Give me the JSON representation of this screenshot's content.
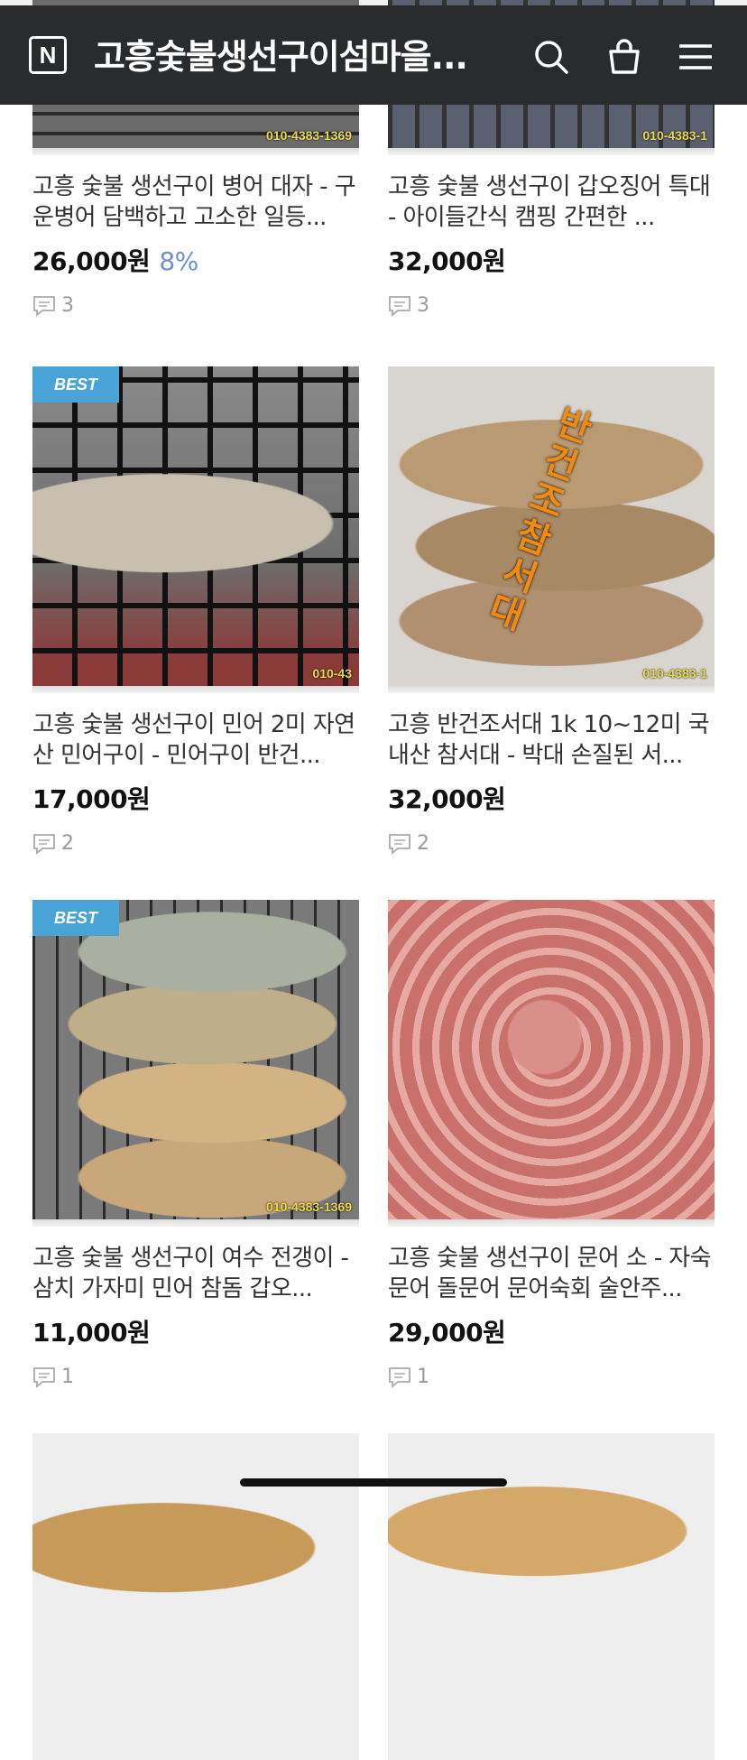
{
  "header": {
    "logo_letter": "N",
    "store_title": "고흥숯불생선구이섬마을...",
    "icons": [
      "search-icon",
      "shopping-bag-icon",
      "hamburger-menu-icon"
    ]
  },
  "colors": {
    "header_bg": "#2a2b2d",
    "badge_bg": "#4aa3d6",
    "discount_text": "#6f8fd1"
  },
  "products": [
    {
      "title": "고흥 숯불 생선구이 병어 대자 - 구운병어 담백하고 고소한 일등...",
      "price": "26,000원",
      "discount": "8%",
      "reviews": "3",
      "badge": "",
      "watermark": "010-4383-1369"
    },
    {
      "title": "고흥 숯불 생선구이 갑오징어 특대 - 아이들간식 캠핑 간편한 ...",
      "price": "32,000원",
      "discount": "",
      "reviews": "3",
      "badge": "",
      "watermark": "010-4383-1"
    },
    {
      "title": "고흥 숯불 생선구이 민어 2미 자연산 민어구이 - 민어구이 반건...",
      "price": "17,000원",
      "discount": "",
      "reviews": "2",
      "badge": "BEST",
      "watermark": "010-43"
    },
    {
      "title": "고흥 반건조서대 1k 10~12미 국내산 참서대 - 박대 손질된 서...",
      "price": "32,000원",
      "discount": "",
      "reviews": "2",
      "badge": "",
      "watermark": "010-4383-1",
      "image_text": "반건조참서대"
    },
    {
      "title": "고흥 숯불 생선구이 여수 전갱이 - 삼치 가자미 민어 참돔 갑오...",
      "price": "11,000원",
      "discount": "",
      "reviews": "1",
      "badge": "BEST",
      "watermark": "010-4383-1369"
    },
    {
      "title": "고흥 숯불 생선구이 문어 소 - 자숙문어 돌문어 문어숙회 술안주...",
      "price": "29,000원",
      "discount": "",
      "reviews": "1",
      "badge": "",
      "watermark": ""
    }
  ]
}
